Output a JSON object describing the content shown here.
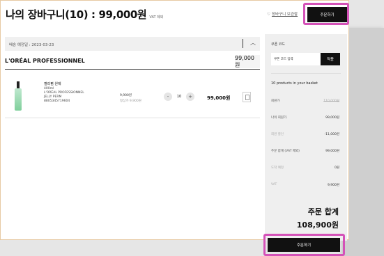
{
  "header": {
    "title": "나의 장바구니(10) : 99,000원",
    "vat_note": "VAT 제외",
    "wishlist_link": "장바구니 보관함",
    "order_button": "주문하기"
  },
  "shipment": {
    "label": "배송 예정일 : 2023-03-23",
    "collapse_icon": "chevron-up-icon"
  },
  "brand": {
    "name": "L'ORÉAL PROFESSIONNEL",
    "subtotal": "99,000원"
  },
  "item": {
    "name": "젤리펌 원제",
    "volume": "400ml",
    "brand": "L'ORÉAL PROFESSIONNEL",
    "line": "JELLY PERM",
    "code": "8805345719604",
    "unit_price": "9,900원",
    "unit_sub": "정상가 9,900원",
    "quantity": "10",
    "minus": "-",
    "plus": "+",
    "total": "99,000원"
  },
  "summary": {
    "coupon_label": "쿠폰 코드",
    "coupon_placeholder": "쿠폰 코드 입력",
    "apply_button": "적용",
    "count_text": "10 products in your basket",
    "rows": [
      {
        "label": "회원가",
        "value": "110,000원"
      },
      {
        "label": "나의 회원가",
        "value": "99,000원"
      },
      {
        "label": "회원 할인",
        "value": "-11,000원"
      },
      {
        "label": "주문 합계 (VAT 제외)",
        "value": "99,000원"
      },
      {
        "label": "도착 예정",
        "value": "0원"
      },
      {
        "label": "VAT",
        "value": "9,900원"
      }
    ],
    "total_label": "주문 합계",
    "total_value": "108,900원",
    "order_button": "주문하기"
  },
  "colors": {
    "highlight": "#d452b8",
    "button": "#111111",
    "page_border": "#e7c9a3"
  }
}
